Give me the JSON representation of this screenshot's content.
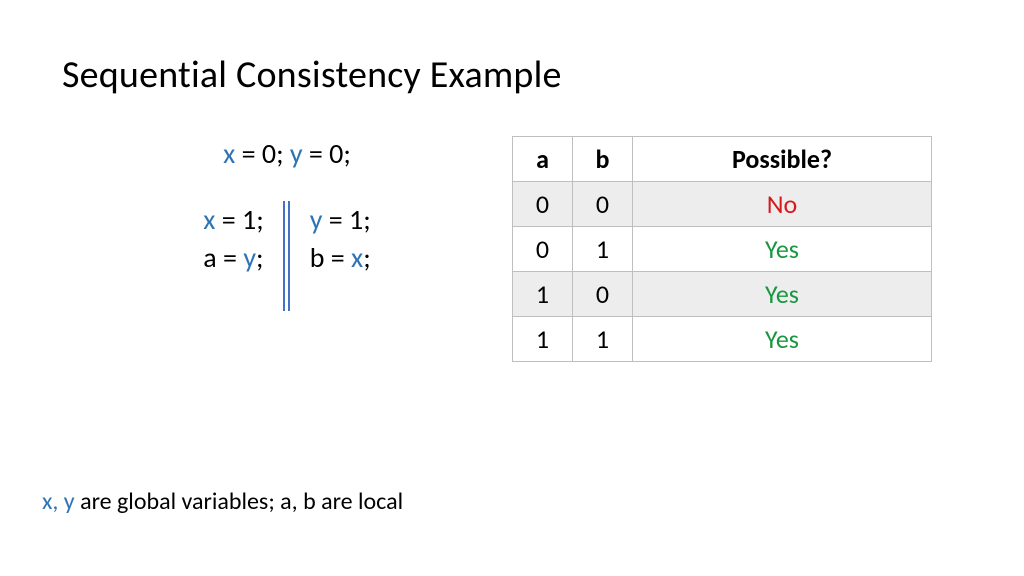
{
  "title": "Sequential Consistency Example",
  "init": {
    "x": "x",
    "xval": " = 0;   ",
    "y": "y",
    "yval": " = 0;"
  },
  "threads": {
    "left": {
      "l1a": "x",
      "l1b": " = 1;",
      "l2a": "a = ",
      "l2b": "y",
      "l2c": ";"
    },
    "right": {
      "l1a": "y",
      "l1b": " = 1;",
      "l2a": "b = ",
      "l2b": "x",
      "l2c": ";"
    }
  },
  "table": {
    "headers": {
      "a": "a",
      "b": "b",
      "p": "Possible?"
    },
    "rows": [
      {
        "a": "0",
        "b": "0",
        "p": "No",
        "cls": "no",
        "shade": true
      },
      {
        "a": "0",
        "b": "1",
        "p": "Yes",
        "cls": "yes",
        "shade": false
      },
      {
        "a": "1",
        "b": "0",
        "p": "Yes",
        "cls": "yes",
        "shade": true
      },
      {
        "a": "1",
        "b": "1",
        "p": "Yes",
        "cls": "yes",
        "shade": false
      }
    ]
  },
  "footnote": {
    "xy": "x, y",
    "rest": " are global variables; a, b are local"
  }
}
